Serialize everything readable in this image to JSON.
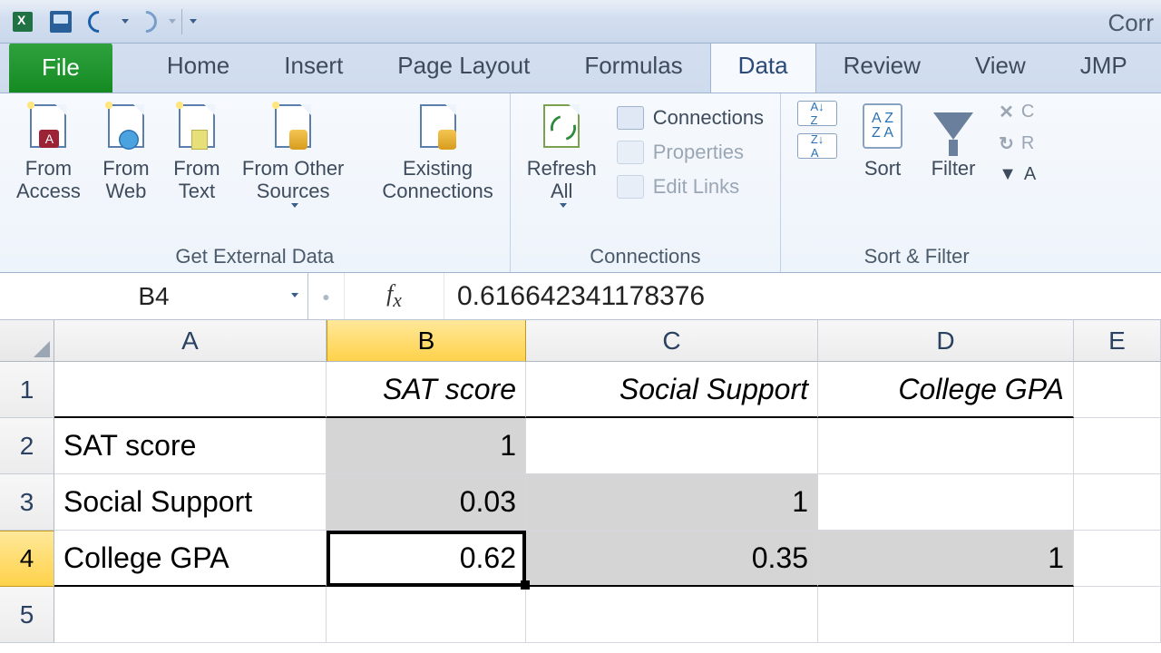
{
  "title_fragment": "Corr",
  "tabs": {
    "file": "File",
    "home": "Home",
    "insert": "Insert",
    "page_layout": "Page Layout",
    "formulas": "Formulas",
    "data": "Data",
    "review": "Review",
    "view": "View",
    "jmp": "JMP"
  },
  "ribbon": {
    "get_external_data": {
      "label": "Get External Data",
      "from_access": "From\nAccess",
      "from_web": "From\nWeb",
      "from_text": "From\nText",
      "from_other": "From Other\nSources",
      "existing": "Existing\nConnections"
    },
    "connections": {
      "label": "Connections",
      "refresh": "Refresh\nAll",
      "conn": "Connections",
      "props": "Properties",
      "edit": "Edit Links"
    },
    "sort_filter": {
      "label": "Sort & Filter",
      "sort": "Sort",
      "filter": "Filter",
      "clear": "C",
      "reapply": "R",
      "advanced": "A"
    }
  },
  "namebox": "B4",
  "formula_value": "0.616642341178376",
  "columns": [
    "A",
    "B",
    "C",
    "D",
    "E"
  ],
  "headers": {
    "B": "SAT score",
    "C": "Social Support",
    "D": "College GPA"
  },
  "rows": {
    "r2": {
      "A": "SAT score",
      "B": "1",
      "C": "",
      "D": ""
    },
    "r3": {
      "A": "Social Support",
      "B": "0.03",
      "C": "1",
      "D": ""
    },
    "r4": {
      "A": "College GPA",
      "B": "0.62",
      "C": "0.35",
      "D": "1"
    }
  },
  "chart_data": {
    "type": "table",
    "title": "Correlation matrix",
    "variables": [
      "SAT score",
      "Social Support",
      "College GPA"
    ],
    "matrix": [
      [
        1,
        null,
        null
      ],
      [
        0.03,
        1,
        null
      ],
      [
        0.62,
        0.35,
        1
      ]
    ],
    "selected_cell": {
      "row": "College GPA",
      "col": "SAT score",
      "value_full": 0.616642341178376
    }
  }
}
